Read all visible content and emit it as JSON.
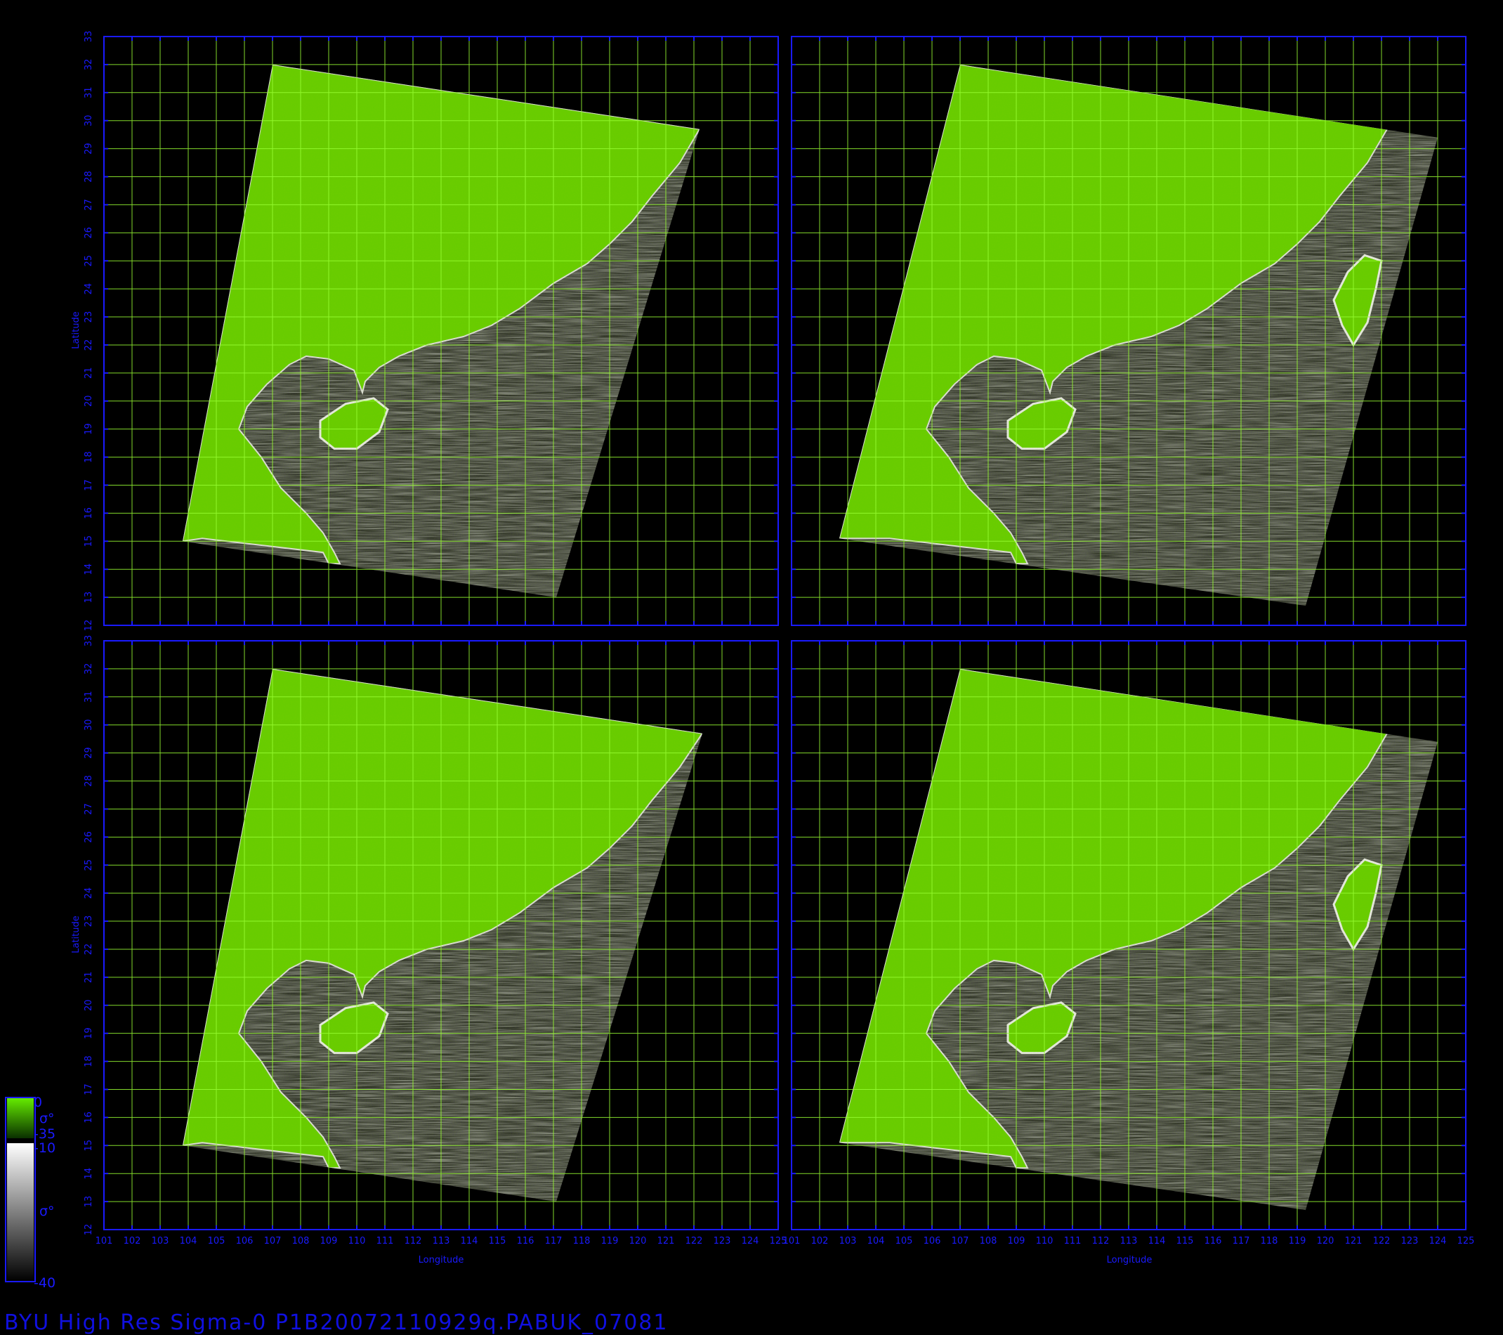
{
  "title": "BYU High Res Sigma-0 P1B20072110929q.PABUK_07081",
  "axes": {
    "xlabel": "Longitude",
    "ylabel": "Latitude",
    "lon_ticks": [
      101,
      102,
      103,
      104,
      105,
      106,
      107,
      108,
      109,
      110,
      111,
      112,
      113,
      114,
      115,
      116,
      117,
      118,
      119,
      120,
      121,
      122,
      123,
      124,
      125
    ],
    "lat_ticks": [
      12,
      13,
      14,
      15,
      16,
      17,
      18,
      19,
      20,
      21,
      22,
      23,
      24,
      25,
      26,
      27,
      28,
      29,
      30,
      31,
      32,
      33
    ],
    "lon_range": [
      101,
      125
    ],
    "lat_range": [
      12,
      33
    ]
  },
  "colorbar": {
    "land_top": "0",
    "land_symbol": "σ°",
    "land_bottom": "-35",
    "ocean_top": "-10",
    "ocean_symbol": "σ°",
    "ocean_bottom": "-40"
  },
  "colors": {
    "land": "#66cc00",
    "frame": "#1a1aff",
    "grid": "#99ff33",
    "ocean_dark": "#2e2e2e",
    "ocean_light": "#8a8a8a"
  },
  "panels": [
    {
      "id": "top-left",
      "swath": [
        [
          107.0,
          32.0
        ],
        [
          122.2,
          29.7
        ],
        [
          117.1,
          13.0
        ],
        [
          103.8,
          15.0
        ]
      ],
      "coast": [
        [
          122.2,
          29.7
        ],
        [
          121.5,
          28.5
        ],
        [
          120.5,
          27.3
        ],
        [
          119.8,
          26.4
        ],
        [
          119.0,
          25.6
        ],
        [
          118.2,
          24.9
        ],
        [
          117.0,
          24.2
        ],
        [
          115.8,
          23.3
        ],
        [
          114.8,
          22.7
        ],
        [
          113.8,
          22.3
        ],
        [
          112.5,
          22.0
        ],
        [
          111.5,
          21.6
        ],
        [
          110.8,
          21.2
        ],
        [
          110.3,
          20.7
        ],
        [
          110.2,
          20.3
        ],
        [
          109.9,
          21.1
        ],
        [
          109.0,
          21.5
        ],
        [
          108.2,
          21.6
        ],
        [
          107.6,
          21.3
        ],
        [
          106.8,
          20.6
        ],
        [
          106.1,
          19.8
        ],
        [
          105.8,
          19.0
        ],
        [
          106.6,
          18.0
        ],
        [
          107.3,
          16.9
        ],
        [
          108.2,
          16.0
        ],
        [
          108.8,
          15.3
        ],
        [
          109.2,
          14.6
        ],
        [
          109.4,
          14.2
        ],
        [
          109.0,
          14.2
        ],
        [
          108.8,
          14.6
        ],
        [
          104.5,
          15.1
        ],
        [
          103.8,
          15.0
        ],
        [
          107.0,
          32.0
        ]
      ],
      "islands": [
        [
          [
            108.7,
            19.3
          ],
          [
            109.6,
            19.9
          ],
          [
            110.6,
            20.1
          ],
          [
            111.1,
            19.7
          ],
          [
            110.8,
            18.9
          ],
          [
            110.0,
            18.3
          ],
          [
            109.2,
            18.3
          ],
          [
            108.7,
            18.7
          ]
        ]
      ]
    },
    {
      "id": "top-right",
      "swath": [
        [
          107.0,
          32.0
        ],
        [
          124.0,
          29.4
        ],
        [
          119.3,
          12.7
        ],
        [
          102.7,
          15.1
        ]
      ],
      "coast": [
        [
          122.2,
          29.7
        ],
        [
          121.5,
          28.5
        ],
        [
          120.5,
          27.3
        ],
        [
          119.8,
          26.4
        ],
        [
          119.0,
          25.6
        ],
        [
          118.2,
          24.9
        ],
        [
          117.0,
          24.2
        ],
        [
          115.8,
          23.3
        ],
        [
          114.8,
          22.7
        ],
        [
          113.8,
          22.3
        ],
        [
          112.5,
          22.0
        ],
        [
          111.5,
          21.6
        ],
        [
          110.8,
          21.2
        ],
        [
          110.3,
          20.7
        ],
        [
          110.2,
          20.3
        ],
        [
          109.9,
          21.1
        ],
        [
          109.0,
          21.5
        ],
        [
          108.2,
          21.6
        ],
        [
          107.6,
          21.3
        ],
        [
          106.8,
          20.6
        ],
        [
          106.1,
          19.8
        ],
        [
          105.8,
          19.0
        ],
        [
          106.6,
          18.0
        ],
        [
          107.3,
          16.9
        ],
        [
          108.2,
          16.0
        ],
        [
          108.8,
          15.3
        ],
        [
          109.2,
          14.6
        ],
        [
          109.4,
          14.2
        ],
        [
          109.0,
          14.2
        ],
        [
          108.8,
          14.6
        ],
        [
          104.5,
          15.1
        ],
        [
          102.7,
          15.1
        ],
        [
          107.0,
          32.0
        ]
      ],
      "islands": [
        [
          [
            108.7,
            19.3
          ],
          [
            109.6,
            19.9
          ],
          [
            110.6,
            20.1
          ],
          [
            111.1,
            19.7
          ],
          [
            110.8,
            18.9
          ],
          [
            110.0,
            18.3
          ],
          [
            109.2,
            18.3
          ],
          [
            108.7,
            18.7
          ]
        ],
        [
          [
            121.0,
            22.0
          ],
          [
            120.6,
            22.7
          ],
          [
            120.3,
            23.6
          ],
          [
            120.8,
            24.6
          ],
          [
            121.4,
            25.2
          ],
          [
            122.0,
            25.0
          ],
          [
            121.8,
            24.0
          ],
          [
            121.5,
            22.8
          ]
        ]
      ]
    },
    {
      "id": "bottom-left",
      "swath": [
        [
          107.0,
          32.0
        ],
        [
          122.3,
          29.7
        ],
        [
          117.1,
          13.0
        ],
        [
          103.8,
          15.0
        ]
      ],
      "coast": [
        [
          122.3,
          29.7
        ],
        [
          121.5,
          28.5
        ],
        [
          120.5,
          27.3
        ],
        [
          119.8,
          26.4
        ],
        [
          119.0,
          25.6
        ],
        [
          118.2,
          24.9
        ],
        [
          117.0,
          24.2
        ],
        [
          115.8,
          23.3
        ],
        [
          114.8,
          22.7
        ],
        [
          113.8,
          22.3
        ],
        [
          112.5,
          22.0
        ],
        [
          111.5,
          21.6
        ],
        [
          110.8,
          21.2
        ],
        [
          110.3,
          20.7
        ],
        [
          110.2,
          20.3
        ],
        [
          109.9,
          21.1
        ],
        [
          109.0,
          21.5
        ],
        [
          108.2,
          21.6
        ],
        [
          107.6,
          21.3
        ],
        [
          106.8,
          20.6
        ],
        [
          106.1,
          19.8
        ],
        [
          105.8,
          19.0
        ],
        [
          106.6,
          18.0
        ],
        [
          107.3,
          16.9
        ],
        [
          108.2,
          16.0
        ],
        [
          108.8,
          15.3
        ],
        [
          109.2,
          14.6
        ],
        [
          109.4,
          14.2
        ],
        [
          109.0,
          14.2
        ],
        [
          108.8,
          14.6
        ],
        [
          104.5,
          15.1
        ],
        [
          103.8,
          15.0
        ],
        [
          107.0,
          32.0
        ]
      ],
      "islands": [
        [
          [
            108.7,
            19.3
          ],
          [
            109.6,
            19.9
          ],
          [
            110.6,
            20.1
          ],
          [
            111.1,
            19.7
          ],
          [
            110.8,
            18.9
          ],
          [
            110.0,
            18.3
          ],
          [
            109.2,
            18.3
          ],
          [
            108.7,
            18.7
          ]
        ]
      ]
    },
    {
      "id": "bottom-right",
      "swath": [
        [
          107.0,
          32.0
        ],
        [
          124.0,
          29.4
        ],
        [
          119.3,
          12.7
        ],
        [
          102.7,
          15.1
        ]
      ],
      "coast": [
        [
          122.2,
          29.7
        ],
        [
          121.5,
          28.5
        ],
        [
          120.5,
          27.3
        ],
        [
          119.8,
          26.4
        ],
        [
          119.0,
          25.6
        ],
        [
          118.2,
          24.9
        ],
        [
          117.0,
          24.2
        ],
        [
          115.8,
          23.3
        ],
        [
          114.8,
          22.7
        ],
        [
          113.8,
          22.3
        ],
        [
          112.5,
          22.0
        ],
        [
          111.5,
          21.6
        ],
        [
          110.8,
          21.2
        ],
        [
          110.3,
          20.7
        ],
        [
          110.2,
          20.3
        ],
        [
          109.9,
          21.1
        ],
        [
          109.0,
          21.5
        ],
        [
          108.2,
          21.6
        ],
        [
          107.6,
          21.3
        ],
        [
          106.8,
          20.6
        ],
        [
          106.1,
          19.8
        ],
        [
          105.8,
          19.0
        ],
        [
          106.6,
          18.0
        ],
        [
          107.3,
          16.9
        ],
        [
          108.2,
          16.0
        ],
        [
          108.8,
          15.3
        ],
        [
          109.2,
          14.6
        ],
        [
          109.4,
          14.2
        ],
        [
          109.0,
          14.2
        ],
        [
          108.8,
          14.6
        ],
        [
          104.5,
          15.1
        ],
        [
          102.7,
          15.1
        ],
        [
          107.0,
          32.0
        ]
      ],
      "islands": [
        [
          [
            108.7,
            19.3
          ],
          [
            109.6,
            19.9
          ],
          [
            110.6,
            20.1
          ],
          [
            111.1,
            19.7
          ],
          [
            110.8,
            18.9
          ],
          [
            110.0,
            18.3
          ],
          [
            109.2,
            18.3
          ],
          [
            108.7,
            18.7
          ]
        ],
        [
          [
            121.0,
            22.0
          ],
          [
            120.6,
            22.7
          ],
          [
            120.3,
            23.6
          ],
          [
            120.8,
            24.6
          ],
          [
            121.4,
            25.2
          ],
          [
            122.0,
            25.0
          ],
          [
            121.8,
            24.0
          ],
          [
            121.5,
            22.8
          ]
        ]
      ]
    }
  ]
}
